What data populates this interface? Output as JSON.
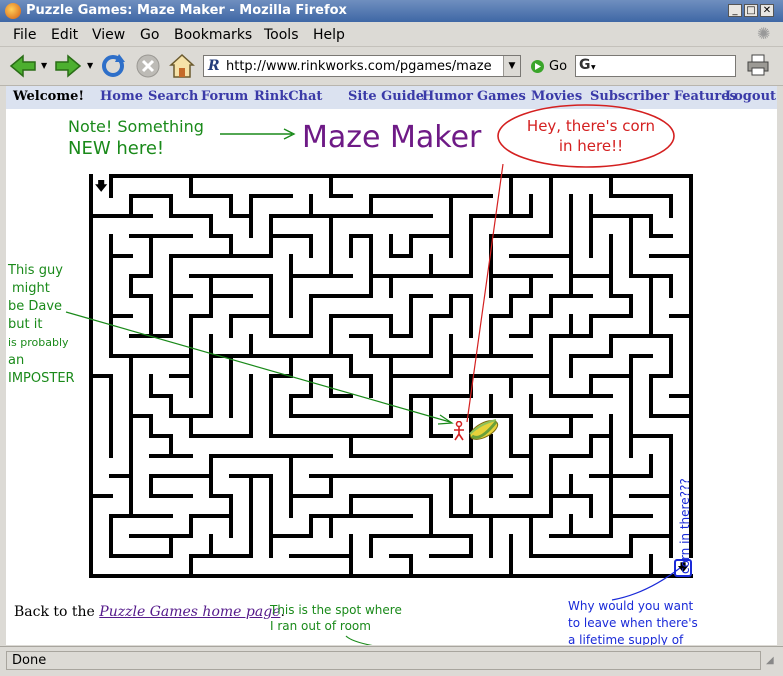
{
  "window": {
    "title": "Puzzle Games: Maze Maker - Mozilla Firefox"
  },
  "menu": [
    "File",
    "Edit",
    "View",
    "Go",
    "Bookmarks",
    "Tools",
    "Help"
  ],
  "toolbar": {
    "url": "http://www.rinkworks.com/pgames/maze",
    "go_label": "Go",
    "search_placeholder": ""
  },
  "nav": {
    "welcome": "Welcome!",
    "links": [
      "Home",
      "Search",
      "Forum",
      "RinkChat",
      "Site Guide",
      "Humor",
      "Games",
      "Movies",
      "Subscriber Features",
      "Logout"
    ]
  },
  "page": {
    "heading": "Maze Maker",
    "back_prefix": "Back to the ",
    "back_link": "Puzzle Games home page",
    "back_suffix": "."
  },
  "annotations": {
    "note_line1": "Note! Something",
    "note_line2": "NEW here!",
    "corn_line1": "Hey, there's corn",
    "corn_line2": "in here!!",
    "guy_lines": [
      "This guy",
      "might",
      "be Dave",
      "but it",
      "is probably",
      "an",
      "IMPOSTER"
    ],
    "spot_line1": "This is the spot where",
    "spot_line2": "I ran out of room",
    "why_line1": "Why would you want",
    "why_line2": "to leave when there's",
    "why_line3": "a lifetime supply of",
    "corn_vertical": "corn in there???",
    "colors": {
      "green": "#1a8a1a",
      "red": "#d42020",
      "blue": "#1a2ad8",
      "purple": "#6e1a86"
    }
  },
  "status": {
    "text": "Done"
  }
}
